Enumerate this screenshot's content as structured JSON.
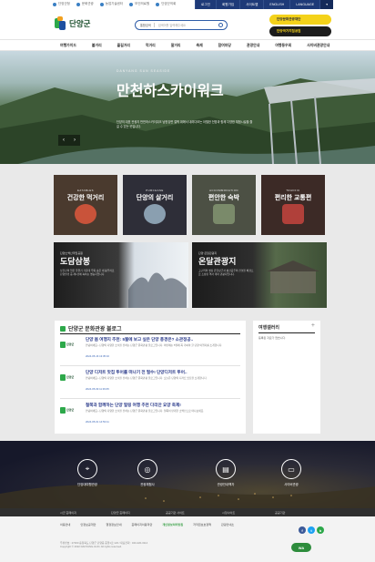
{
  "topbar": {
    "links": [
      "단양군청",
      "문화관광",
      "농업기술센터",
      "보건의료원",
      "단양군의회"
    ],
    "utils": [
      "로그인",
      "회원가입",
      "사이트맵",
      "ENGLISH",
      "LANGUAGE"
    ],
    "arrow": "▾"
  },
  "header": {
    "logo_text": "단양군",
    "search": {
      "select": "통합검색",
      "placeholder": "검색어를 입력해주세요"
    },
    "banners": [
      "단양문화관광재단",
      "단양국가지질공원"
    ]
  },
  "gnb": [
    "여행가이드",
    "볼거리",
    "즐길거리",
    "먹거리",
    "잘거리",
    "축제",
    "참여마당",
    "관광안내",
    "여행동우회",
    "사이버관광안내"
  ],
  "hero": {
    "tag": "DANYANG SUN SEASIDE",
    "title": "만천하스카이워크",
    "desc": "단양의 대표 관광지 만천하스카이워크 남한강변 절벽 위에서 내려다보는 아찔한 전망과 함께 다양한 체험시설을 즐길 수 있는 곳입니다.",
    "prev": "‹",
    "next": "›"
  },
  "categories": [
    {
      "en": "EATABLES",
      "ko": "건강한 먹거리",
      "bg": "#4a3a2e",
      "art": "#c9533a"
    },
    {
      "en": "PURCHASE",
      "ko": "단양의 살거리",
      "bg": "#2e2e38",
      "art": "#8a9fb0"
    },
    {
      "en": "ACCOMMODATION",
      "ko": "편안한 숙박",
      "bg": "#4c5044",
      "art": "#7a8a6a"
    },
    {
      "en": "TRAFFIC",
      "ko": "편리한 교통편",
      "bg": "#3c2a26",
      "art": "#b0403a"
    }
  ],
  "wide_tiles": [
    {
      "small": "단양소백산국립공원",
      "big": "도담삼봉",
      "desc": "남한강의 맑은 물줄기 가운데 우뚝 솟은 세 봉우리로 단양팔경 중 제1경에 속하는 명승지입니다."
    },
    {
      "small": "단양 온달관광지",
      "big": "온달관광지",
      "desc": "고구려의 명장 온달장군과 평강공주의 전설을 배경으로 조성된 역사 테마 관광지입니다."
    }
  ],
  "blog": {
    "title": "단양군 문화관광 블로그",
    "thumb_label": "단양군",
    "posts": [
      {
        "title": "단양 봄 여행지 추천: 5월에 보고 싶은 단양 풍경은? 소관정공..",
        "summary": "안녕하세요~ 단양의 다양한 소식을 전하는 단양군 문화관광 블로그입니다. 이번에는 5월에 꼭 가봐야 할 단양 여행지를 소개합니다.",
        "date": "2024-05-16 13:35:16"
      },
      {
        "title": "단양 디저트 맛집 투어를 떠나기 전 필수! 단양디저트 투어..",
        "summary": "안녕하세요~ 단양의 다양한 소식을 전하는 단양군 문화관광 블로그입니다. 오늘은 단양의 디저트 맛집을 소개합니다.",
        "date": "2024-05-09 11:39:35"
      },
      {
        "title": "철쭉과 함께하는 단양 힐링 여행 추천 다리안 요양 축제!",
        "summary": "안녕하세요~ 단양의 다양한 소식을 전하는 단양군 문화관광 블로그입니다. 철쭉이 만개한 소백산으로 떠나보세요.",
        "date": "2024-05-01 14:53:11"
      }
    ]
  },
  "gallery": {
    "title": "여행갤러리",
    "plus": "+",
    "message": "등록된 자료가 없습니다."
  },
  "quick_menu": [
    {
      "label": "단양대여행관광",
      "icon": "map-pin-icon",
      "glyph": "⌖"
    },
    {
      "label": "관광체험사",
      "icon": "camera-icon",
      "glyph": "◎"
    },
    {
      "label": "관광안내책자",
      "icon": "book-icon",
      "glyph": "▤"
    },
    {
      "label": "사이버관광",
      "icon": "monitor-icon",
      "glyph": "▭"
    }
  ],
  "site_bar": [
    "시군 홈페이지",
    "단양군 홈페이지",
    "공공기관 사이트",
    "시청사이트",
    "공공기관"
  ],
  "footer": {
    "links": [
      "이용안내",
      "안정보공개안",
      "행정정보안내",
      "홈페이지이용약관",
      "개인정보처리방침",
      "저작권보호정책",
      "관광안내소"
    ],
    "address": "우편번호 : 27000 충청북도 단양군 단양읍 중앙1로 123 / 대표전화 : 043-420-3114",
    "copyright": "Copyright © 2022 DANYANG-GUN. All rights reserved.",
    "sns": [
      "f",
      "t",
      "b"
    ],
    "wa_mark": "WA"
  },
  "colors": {
    "brand_green": "#1b4e2c",
    "accent_blue": "#2f5da8",
    "nav_blue": "#1e3a78",
    "yellow": "#f4d21a"
  }
}
